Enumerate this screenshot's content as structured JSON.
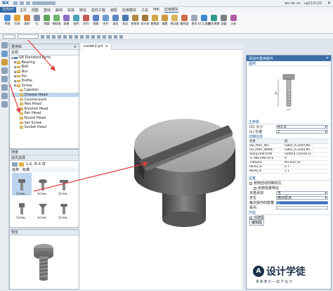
{
  "titlebar": {
    "app": "NX",
    "file_menu": "文件(F)",
    "right_text": "wo de vx : ug110120"
  },
  "ribbon_tabs": [
    "主页",
    "视图",
    "直线",
    "曲线",
    "实体",
    "特征",
    "逆向工程",
    "装配",
    "应用模块",
    "工具",
    "PMI",
    "应用模块"
  ],
  "ribbon_buttons": [
    "草图",
    "拉伸",
    "旋转",
    "孔",
    "倒圆",
    "倒斜角",
    "拔模",
    "抽壳",
    "阵列",
    "镜像",
    "合并",
    "减去",
    "相交",
    "修剪体",
    "拆分体",
    "替换面",
    "偏置",
    "移动面",
    "删除面",
    "更多",
    "GC工具箱",
    "同步建模",
    "测量",
    "分析"
  ],
  "navigator": {
    "title": "重用库",
    "column": "名称",
    "root": "GB Standard Parts",
    "items": [
      "Bearing",
      "Bolt",
      "Nut",
      "Pin",
      "Profile",
      "Screw"
    ],
    "screw_children": [
      "Capstan",
      "Cheese Head",
      "Countersunk",
      "Hex Head",
      "Knurled Head",
      "Pan Head",
      "Round Head",
      "Set Screw",
      "Socket Head"
    ],
    "selected": "Cheese Head"
  },
  "library": {
    "search_title": "搜索",
    "member_title": "成员选择",
    "filter_text": "1-6, 共 6 项",
    "tabs": [
      "名称",
      "标准"
    ],
    "thumbs": [
      "Screw...",
      "Screw...",
      "Screw...",
      "Screw...",
      "Screw...",
      "Screw..."
    ]
  },
  "preview_title": "预览",
  "viewport": {
    "tab_label": "model2.prt",
    "tab_close": "×"
  },
  "dialog": {
    "title": "添加可重用组件",
    "section_figure": "图例",
    "section_main_params": "主参数",
    "size_label": "(D) 大小",
    "size_value": "M1.6",
    "length_label": "(L) 长度",
    "length_value": "2",
    "section_details": "详细信息",
    "details_header": [
      "名称",
      "值"
    ],
    "details": [
      [
        "DB_PART_NO",
        "GB65_A-2000,M1..."
      ],
      [
        "OS_PART_NAME",
        "GB65_A-2000,M1..."
      ],
      [
        "$DESCRIPTION",
        "Slotted Cheese H..."
      ],
      [
        "TC-INSTANTIATE",
        "0"
      ],
      [
        "THREAD",
        "M1.6x0.35"
      ],
      [
        "HEAD_H",
        "0.7"
      ],
      [
        "HEAD_K",
        "1.1"
      ]
    ],
    "section_settings": "设置",
    "opt1": "使用自动判断的孔",
    "opt2": "启用强置特征",
    "mode_label": "多重添加",
    "mode_value": "无",
    "pos_label": "定位",
    "pos_value": "绝对原点",
    "tol_label": "每次操作的数量",
    "tol_value": "1",
    "series_label": "系列",
    "section_open": "开始",
    "opt3": "创建图",
    "opt4": "编辑图",
    "figure_dim": "L"
  },
  "watermark": {
    "title": "设计学徒",
    "subtitle": "来 和 我 们 一 起 学 设 计"
  },
  "colors": {
    "accent": "#3a6fa8",
    "arrow": "#e23b3b",
    "selection": "#bcd4ee"
  }
}
